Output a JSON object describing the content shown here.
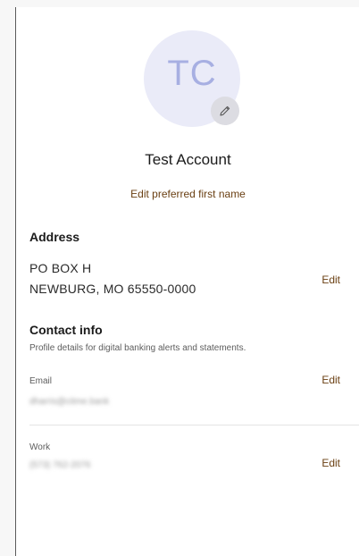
{
  "profile": {
    "initials": "TC",
    "name": "Test Account",
    "edit_first_name_label": "Edit preferred first name"
  },
  "address": {
    "title": "Address",
    "line1": "PO BOX H",
    "line2": "NEWBURG, MO 65550-0000",
    "edit_label": "Edit"
  },
  "contact": {
    "title": "Contact info",
    "subtitle": "Profile details for digital banking alerts and statements.",
    "email_label": "Email",
    "email_value": "dharris@citme.bank",
    "email_edit_label": "Edit",
    "work_label": "Work",
    "work_value": "(573) 762-2076",
    "work_edit_label": "Edit"
  },
  "icons": {
    "avatar_edit": "pencil-icon"
  },
  "colors": {
    "accent": "#6a3f12",
    "avatar_bg": "#eaebf8",
    "avatar_text": "#a7afe2"
  }
}
